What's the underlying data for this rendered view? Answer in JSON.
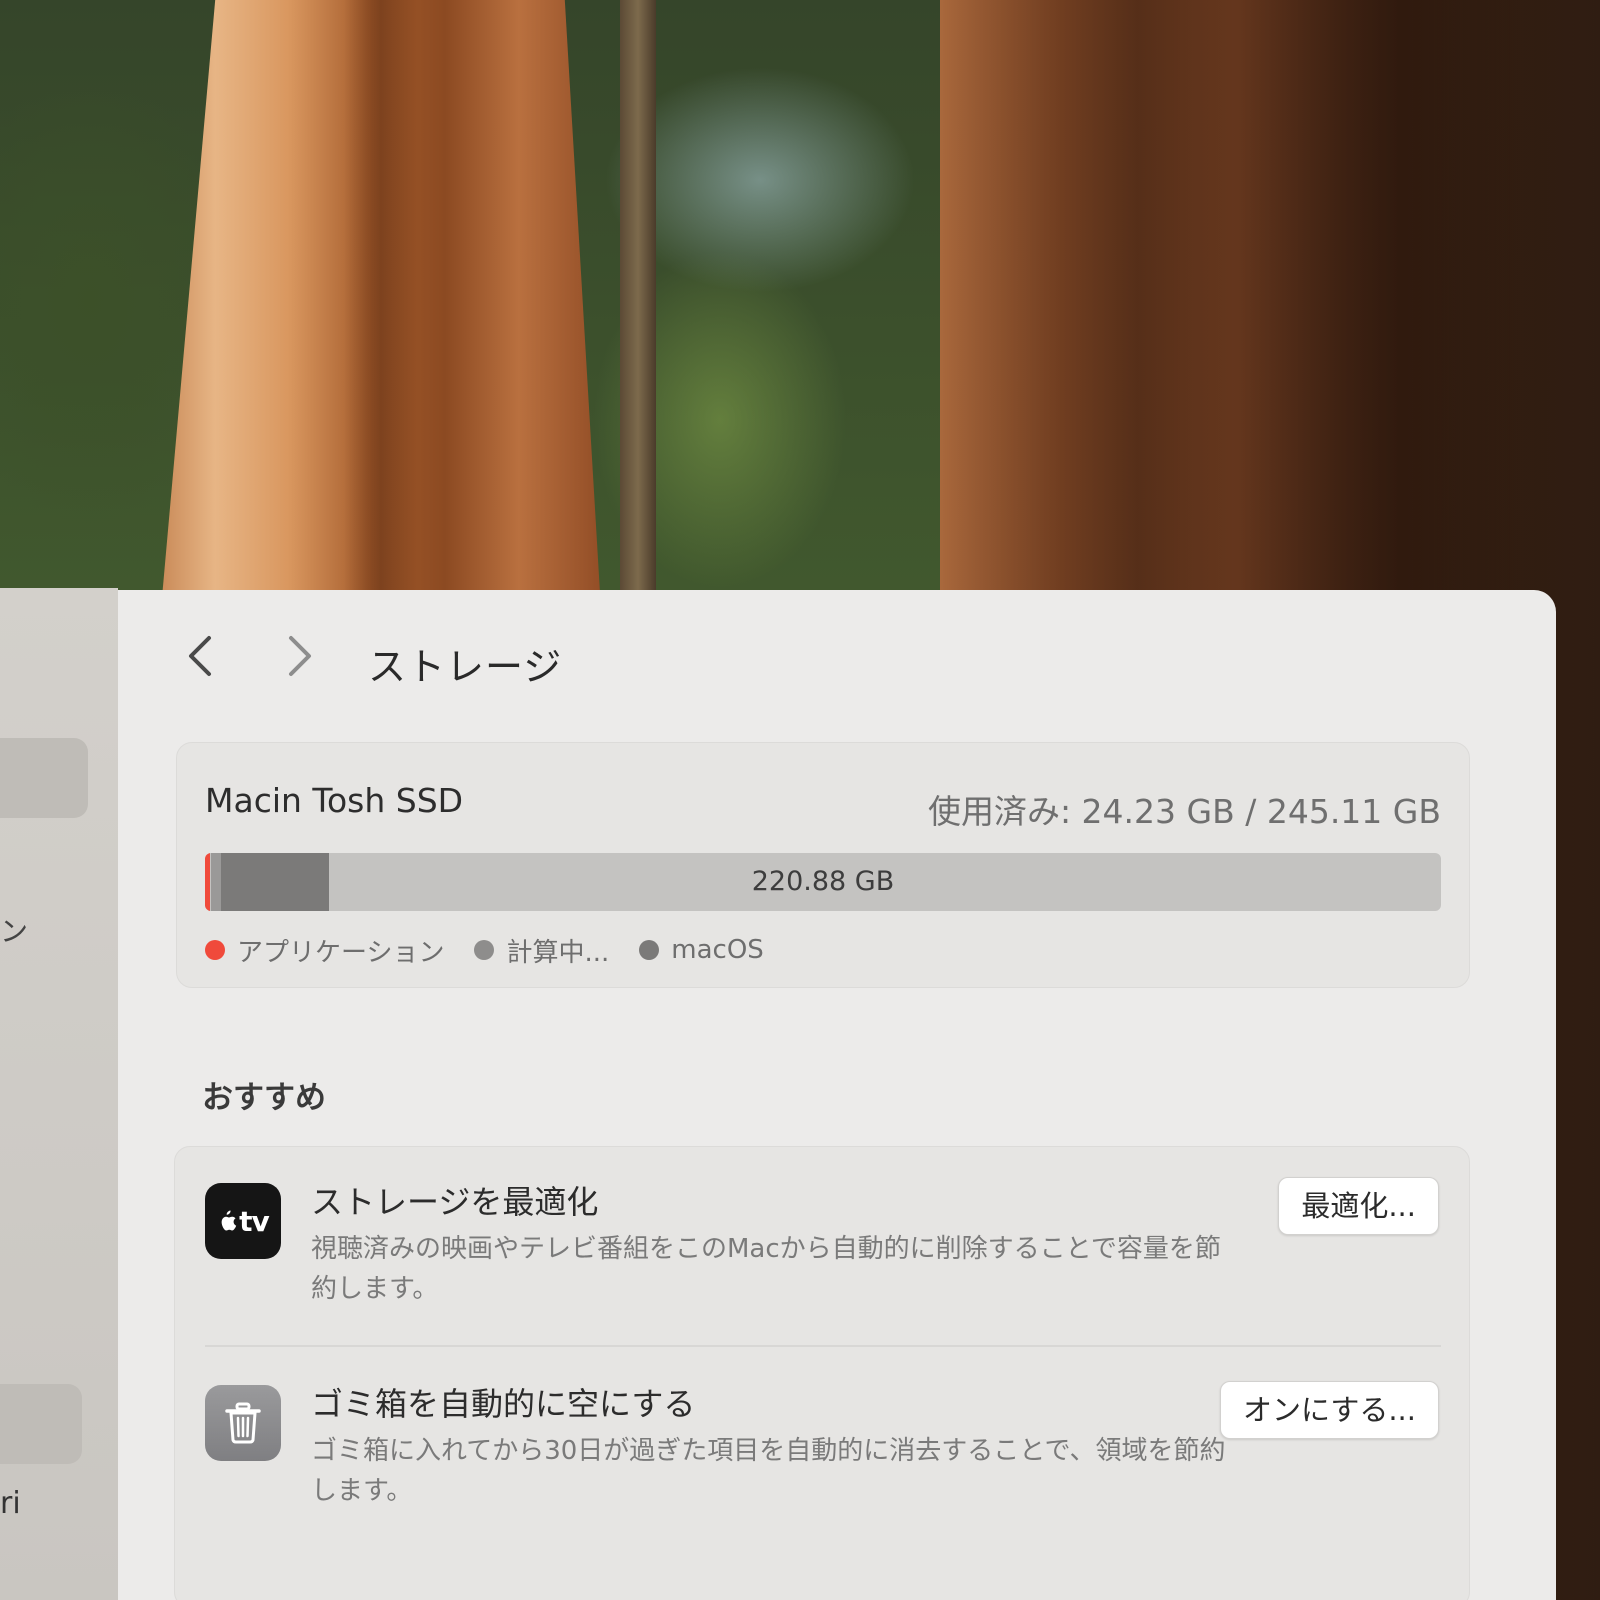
{
  "sidebar": {
    "fragment_1": "ン",
    "fragment_2": "ri"
  },
  "toolbar": {
    "title": "ストレージ",
    "back_icon": "chevron-left-icon",
    "forward_icon": "chevron-right-icon"
  },
  "storage": {
    "disk_name": "Macin Tosh SSD",
    "used_summary": "使用済み: 24.23 GB / 245.11 GB",
    "free_label": "220.88 GB",
    "segments": [
      {
        "name": "アプリケーション",
        "fraction": 0.004,
        "color": "#f04a3b"
      },
      {
        "name": "計算中...",
        "fraction": 0.008,
        "color": "#9a9998"
      },
      {
        "name": "macOS",
        "fraction": 0.087,
        "color": "#7b7a79"
      }
    ],
    "legend": [
      {
        "label": "アプリケーション",
        "color": "#f04a3b"
      },
      {
        "label": "計算中...",
        "color": "#8e8d8c"
      },
      {
        "label": "macOS",
        "color": "#7b7a79"
      }
    ]
  },
  "recommendations": {
    "heading": "おすすめ",
    "items": [
      {
        "icon": "apple-tv-icon",
        "glyph": "tv",
        "title": "ストレージを最適化",
        "description": "視聴済みの映画やテレビ番組をこのMacから自動的に削除することで容量を節約します。",
        "button": "最適化..."
      },
      {
        "icon": "trash-icon",
        "title": "ゴミ箱を自動的に空にする",
        "description": "ゴミ箱に入れてから30日が過ぎた項目を自動的に消去することで、領域を節約します。",
        "button": "オンにする..."
      }
    ]
  }
}
